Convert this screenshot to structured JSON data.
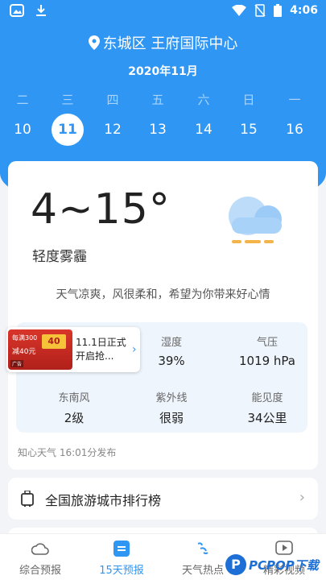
{
  "status_bar": {
    "time": "4:06"
  },
  "header": {
    "location": "东城区 王府国际中心",
    "month": "2020年11月"
  },
  "week": [
    {
      "weekday": "二",
      "date": "10"
    },
    {
      "weekday": "三",
      "date": "11"
    },
    {
      "weekday": "四",
      "date": "12"
    },
    {
      "weekday": "五",
      "date": "13"
    },
    {
      "weekday": "六",
      "date": "14"
    },
    {
      "weekday": "日",
      "date": "15"
    },
    {
      "weekday": "一",
      "date": "16"
    }
  ],
  "selected_day_index": 1,
  "weather": {
    "temperature": "4~15°",
    "condition": "轻度雾霾",
    "tip": "天气凉爽，风很柔和，希望为你带来好心情",
    "icon": "cloud-haze-icon"
  },
  "stats": [
    {
      "label": "湿度",
      "value": "39%"
    },
    {
      "label": "气压",
      "value": "1019 hPa"
    },
    {
      "label": "东南风",
      "value": "2级"
    },
    {
      "label": "紫外线",
      "value": "很弱"
    },
    {
      "label": "能见度",
      "value": "34公里"
    }
  ],
  "ad": {
    "text": "11.1日正式开启抢...",
    "img_line1": "每满300",
    "img_line2": "减40元",
    "coupon": "40",
    "tag": "广告"
  },
  "published": "知心天气 16:01分发布",
  "ranking": {
    "label": "全国旅游城市排行榜"
  },
  "tabs": [
    {
      "label": "综合预报",
      "icon": "cloud-outline-icon"
    },
    {
      "label": "15天预报",
      "icon": "list-icon"
    },
    {
      "label": "天气热点",
      "icon": "wind-icon"
    },
    {
      "label": "精彩视频",
      "icon": "play-icon"
    }
  ],
  "active_tab": 1,
  "watermark": {
    "logo": "P",
    "text": "PCPOP下载"
  },
  "colors": {
    "primary": "#2f96f4",
    "background": "#f2f4f7"
  }
}
